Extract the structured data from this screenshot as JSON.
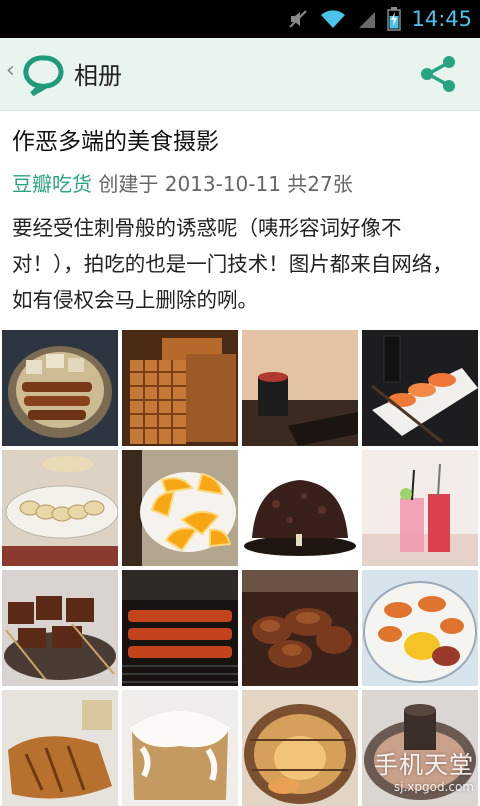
{
  "status_bar": {
    "time": "14:45",
    "icons": [
      "mute-icon",
      "wifi-icon",
      "signal-icon",
      "battery-charging-icon"
    ]
  },
  "app_bar": {
    "back_icon": "back-chevron-icon",
    "logo_icon": "speech-bubble-logo-icon",
    "title": "相册",
    "share_icon": "share-icon"
  },
  "album": {
    "title": "作恶多端的美食摄影",
    "author": "豆瓣吃货",
    "created_prefix": " 创建于 2013-10-11 共27张",
    "description": "要经受住刺骨般的诱惑呢（咦形容词好像不对！），拍吃的也是一门技术！图片都来自网络，如有侵权会马上删除的咧。"
  },
  "photos": [
    {
      "name": "photo-tofu-skewers-bowl"
    },
    {
      "name": "photo-wafer-cake"
    },
    {
      "name": "photo-sushi-roll-dark"
    },
    {
      "name": "photo-salmon-sushi-plate"
    },
    {
      "name": "photo-dumplings-plate"
    },
    {
      "name": "photo-orange-slices"
    },
    {
      "name": "photo-chocolate-lava-cake"
    },
    {
      "name": "photo-pink-drinks"
    },
    {
      "name": "photo-grilled-skewers-bowl"
    },
    {
      "name": "photo-grill-skewers"
    },
    {
      "name": "photo-bbq-meat-plate"
    },
    {
      "name": "photo-shrimp-dish"
    },
    {
      "name": "photo-grilled-fish"
    },
    {
      "name": "photo-cinnamon-roll"
    },
    {
      "name": "photo-scallop-shell"
    },
    {
      "name": "photo-hot-pot"
    }
  ],
  "watermark": {
    "main": "手机天堂",
    "url": "sj.xpgod.com"
  },
  "colors": {
    "status_bar_bg": "#000000",
    "clock": "#4cc3ea",
    "app_bar_bg": "#e9f4ef",
    "accent_green": "#2aa57f"
  }
}
